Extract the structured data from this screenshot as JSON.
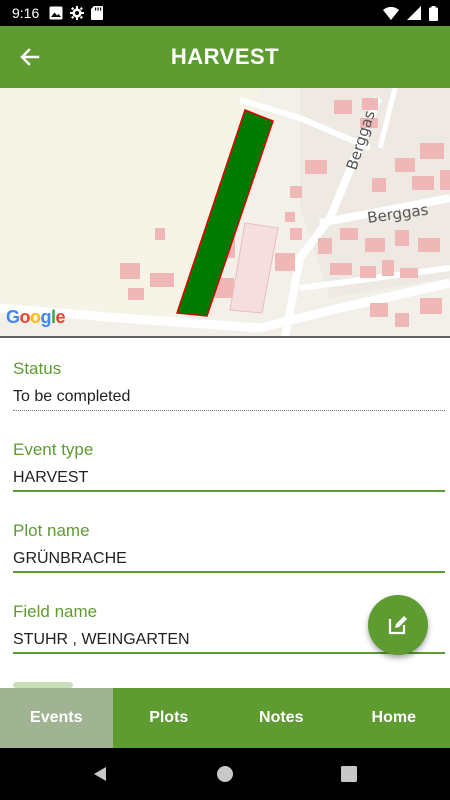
{
  "status_bar": {
    "time": "9:16"
  },
  "app_bar": {
    "title": "HARVEST"
  },
  "map": {
    "street_label": "Berggas",
    "street_label_rotated": "Berggas",
    "attribution_letters": [
      "G",
      "o",
      "o",
      "g",
      "l",
      "e"
    ],
    "plot_fill_color": "#007a00",
    "plot_border_color": "#e00000"
  },
  "fields": [
    {
      "label": "Status",
      "value": "To be completed"
    },
    {
      "label": "Event type",
      "value": "HARVEST"
    },
    {
      "label": "Plot name",
      "value": "GRÜNBRACHE"
    },
    {
      "label": "Field name",
      "value": "STUHR , WEINGARTEN"
    }
  ],
  "bottom_nav": {
    "tabs": [
      "Events",
      "Plots",
      "Notes",
      "Home"
    ],
    "active": "Events"
  },
  "colors": {
    "primary": "#5e9c32",
    "active_tab": "#a0b493"
  }
}
